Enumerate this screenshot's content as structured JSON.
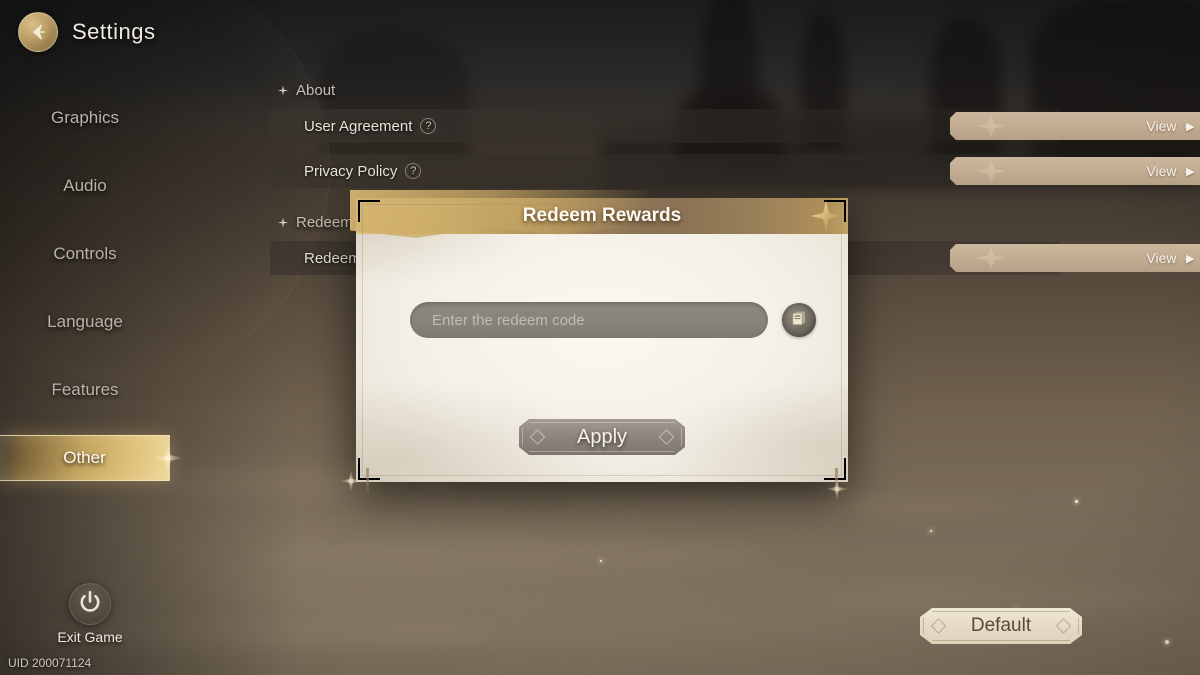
{
  "header": {
    "title": "Settings",
    "back_icon": "back-arrow-icon"
  },
  "sidebar": {
    "items": [
      {
        "label": "Graphics",
        "selected": false
      },
      {
        "label": "Audio",
        "selected": false
      },
      {
        "label": "Controls",
        "selected": false
      },
      {
        "label": "Language",
        "selected": false
      },
      {
        "label": "Features",
        "selected": false
      },
      {
        "label": "Other",
        "selected": true
      }
    ]
  },
  "content": {
    "sections": [
      {
        "title": "About",
        "rows": [
          {
            "label": "User Agreement",
            "help": "?",
            "action": "View",
            "action_arrow": "·▶"
          },
          {
            "label": "Privacy Policy",
            "help": "?",
            "action": "View",
            "action_arrow": "·▶"
          }
        ]
      },
      {
        "title": "Redeem Code",
        "rows": [
          {
            "label": "Redeem Code",
            "help": "?",
            "action": "View",
            "action_arrow": "·▶"
          }
        ]
      }
    ]
  },
  "modal": {
    "title": "Redeem Rewards",
    "close_icon": "close-star-icon",
    "input": {
      "value": "",
      "placeholder": "Enter the redeem code"
    },
    "paste_icon": "paste-clipboard-icon",
    "apply_label": "Apply"
  },
  "footer": {
    "exit_label": "Exit Game",
    "power_icon": "power-icon",
    "uid": "UID 200071124",
    "default_label": "Default"
  },
  "colors": {
    "gold_accent": "#d4b470",
    "selected_tab": "#e2c57e",
    "button_beige": "#c2ad93",
    "modal_paper": "#f4f0e7",
    "apply_gray": "#8e867e",
    "default_cream": "#e6dcc6",
    "text_light": "#efe9df",
    "text_muted": "#b9b2a8"
  }
}
